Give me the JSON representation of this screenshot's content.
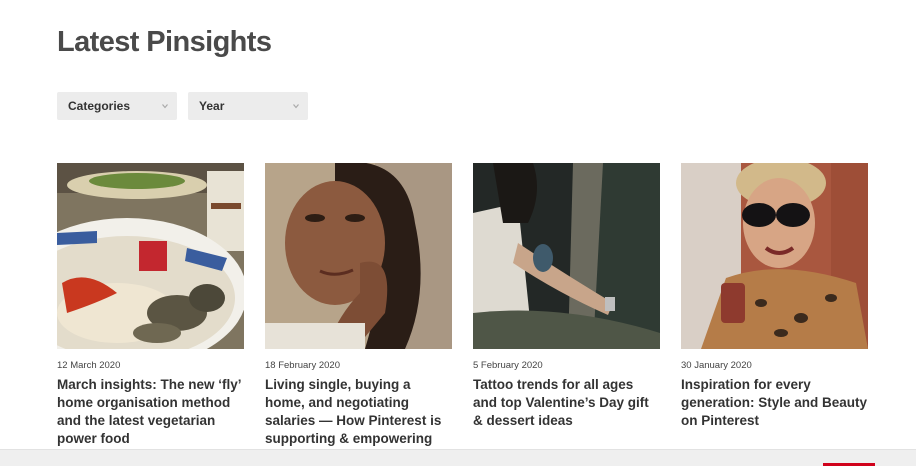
{
  "header": {
    "title": "Latest Pinsights"
  },
  "filters": {
    "categories_label": "Categories",
    "year_label": "Year"
  },
  "articles": [
    {
      "date": "12 March 2020",
      "title": "March insights: The new ‘fly’ home organisation method and the latest vegetarian power food"
    },
    {
      "date": "18 February 2020",
      "title": "Living single, buying a home, and negotiating salaries — How Pinterest is supporting & empowering women"
    },
    {
      "date": "5 February 2020",
      "title": "Tattoo trends for all ages and top Valentine’s Day gift & dessert ideas"
    },
    {
      "date": "30 January 2020",
      "title": "Inspiration for every generation: Style and Beauty on Pinterest"
    }
  ],
  "colors": {
    "accent": "#d0021b",
    "title": "#4a4a4a",
    "filter_bg": "#ececec"
  },
  "icons": {
    "dropdown": "chevron-down-icon"
  }
}
